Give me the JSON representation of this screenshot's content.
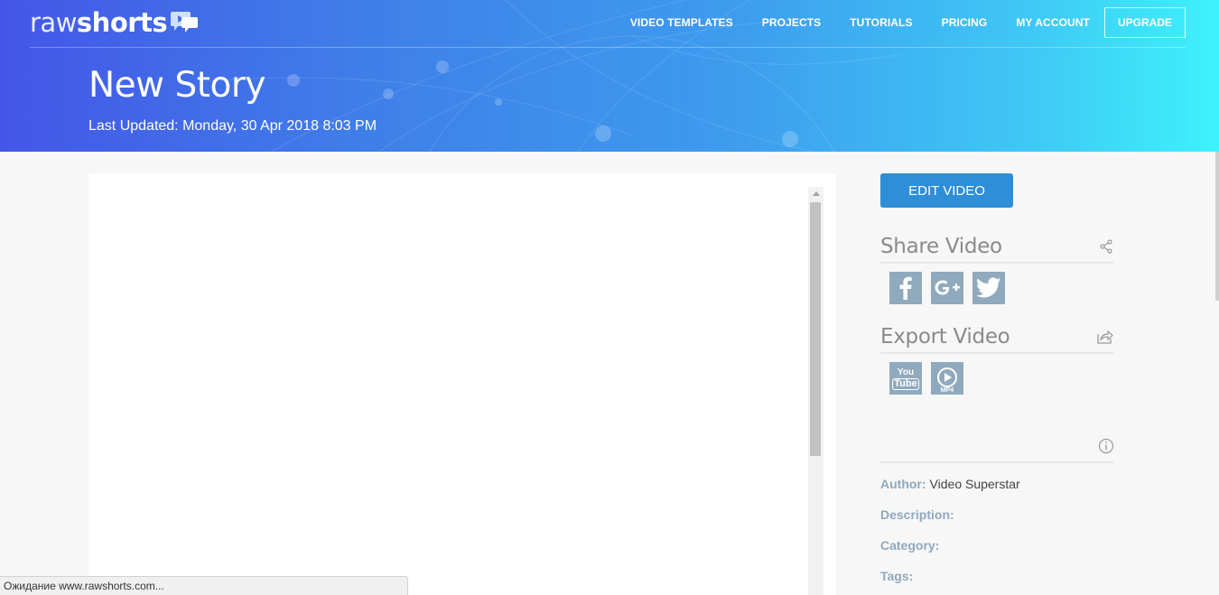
{
  "brand": {
    "logo_light": "raw",
    "logo_bold": "shorts"
  },
  "nav": {
    "items": [
      "VIDEO TEMPLATES",
      "PROJECTS",
      "TUTORIALS",
      "PRICING",
      "MY ACCOUNT"
    ],
    "upgrade_label": "UPGRADE"
  },
  "header": {
    "title": "New Story",
    "last_updated": "Last Updated: Monday, 30 Apr 2018 8:03 PM"
  },
  "sidebar": {
    "edit_label": "EDIT VIDEO",
    "share_title": "Share Video",
    "share_icons": [
      "facebook-icon",
      "google-plus-icon",
      "twitter-icon"
    ],
    "export_title": "Export Video",
    "export_icons": [
      "youtube-icon",
      "mp4-icon"
    ],
    "meta": {
      "author_label": "Author:",
      "author_value": "Video Superstar",
      "description_label": "Description:",
      "category_label": "Category:",
      "tags_label": "Tags:"
    },
    "youtube_text_top": "You",
    "youtube_text_bottom": "Tube",
    "mp4_text": "MP4"
  },
  "status_bar": {
    "text": "Ожидание www.rawshorts.com..."
  },
  "colors": {
    "accent_blue": "#2e8ed8",
    "icon_gray_blue": "#8fa9bd",
    "gradient_start": "#4456e8",
    "gradient_end": "#3ef2fb"
  }
}
